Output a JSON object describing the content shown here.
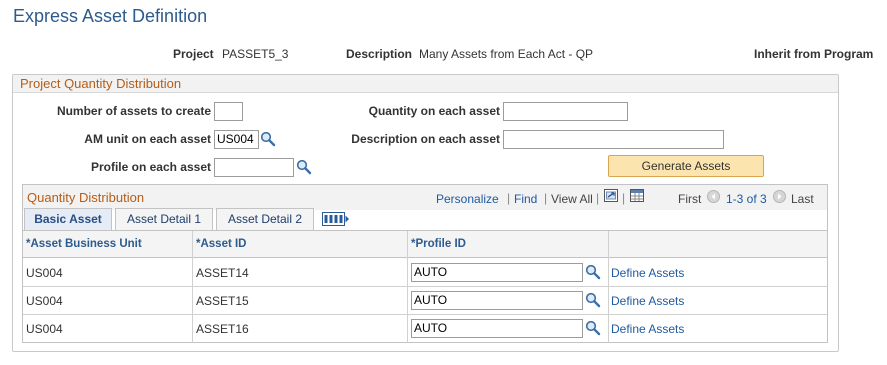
{
  "page": {
    "title": "Express Asset Definition"
  },
  "header": {
    "project_label": "Project",
    "project_value": "PASSET5_3",
    "description_label": "Description",
    "description_value": "Many Assets from Each Act - QP",
    "inherit_label": "Inherit from Program"
  },
  "distribution": {
    "title": "Project Quantity Distribution",
    "num_assets_label": "Number of assets to create",
    "num_assets_value": "",
    "am_unit_label": "AM unit on each asset",
    "am_unit_value": "US004",
    "profile_label": "Profile on each asset",
    "profile_value": "",
    "qty_label": "Quantity on each asset",
    "qty_value": "",
    "desc_label": "Description on each asset",
    "desc_value": "",
    "generate_button": "Generate Assets"
  },
  "grid": {
    "title": "Quantity Distribution",
    "personalize": "Personalize",
    "find": "Find",
    "view_all": "View All",
    "first": "First",
    "range": "1-3 of 3",
    "last": "Last",
    "tabs": [
      "Basic Asset",
      "Asset Detail 1",
      "Asset Detail 2"
    ],
    "columns": [
      "*Asset Business Unit",
      "*Asset ID",
      "*Profile ID"
    ],
    "rows": [
      {
        "unit": "US004",
        "asset_id": "ASSET14",
        "profile": "AUTO",
        "action": "Define Assets"
      },
      {
        "unit": "US004",
        "asset_id": "ASSET15",
        "profile": "AUTO",
        "action": "Define Assets"
      },
      {
        "unit": "US004",
        "asset_id": "ASSET16",
        "profile": "AUTO",
        "action": "Define Assets"
      }
    ]
  },
  "colors": {
    "title_blue": "#2c5b8e",
    "group_orange": "#b65c15",
    "link_blue": "#1f5aa0",
    "button_fill": "#fce4ae"
  },
  "icons": [
    "lookup-icon",
    "download-icon",
    "grid-icon",
    "prev-icon",
    "next-icon",
    "show-all-columns-icon"
  ]
}
